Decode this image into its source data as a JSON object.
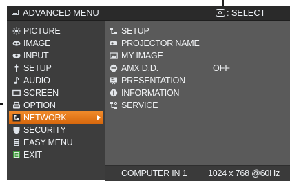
{
  "header": {
    "title": "ADVANCED MENU",
    "select_label": ": SELECT",
    "select_icon": "select-button-icon"
  },
  "left_menu": {
    "items": [
      {
        "label": "PICTURE",
        "icon": "picture-icon"
      },
      {
        "label": "IMAGE",
        "icon": "image-icon"
      },
      {
        "label": "INPUT",
        "icon": "input-icon"
      },
      {
        "label": "SETUP",
        "icon": "setup-icon"
      },
      {
        "label": "AUDIO",
        "icon": "audio-icon"
      },
      {
        "label": "SCREEN",
        "icon": "screen-icon"
      },
      {
        "label": "OPTION",
        "icon": "option-icon"
      },
      {
        "label": "NETWORK",
        "icon": "network-icon",
        "selected": true
      },
      {
        "label": "SECURITY",
        "icon": "security-icon"
      },
      {
        "label": "EASY MENU",
        "icon": "easy-menu-icon"
      },
      {
        "label": "EXIT",
        "icon": "exit-icon"
      }
    ]
  },
  "sub_menu": {
    "items": [
      {
        "label": "SETUP",
        "icon": "network-setup-icon"
      },
      {
        "label": "PROJECTOR NAME",
        "icon": "projector-name-icon"
      },
      {
        "label": "MY IMAGE",
        "icon": "my-image-icon"
      },
      {
        "label": "AMX D.D.",
        "icon": "amx-icon",
        "value": "OFF"
      },
      {
        "label": "PRESENTATION",
        "icon": "presentation-icon"
      },
      {
        "label": "INFORMATION",
        "icon": "information-icon"
      },
      {
        "label": "SERVICE",
        "icon": "service-icon"
      }
    ]
  },
  "footer": {
    "input": "COMPUTER IN 1",
    "resolution": "1024 x 768 @60Hz"
  },
  "colors": {
    "selected_highlight": "#e8791a",
    "left_menu_bg": "#3d3d3d",
    "sub_menu_bg": "#5a5a5a",
    "header_bg": "#2a2a2a"
  }
}
